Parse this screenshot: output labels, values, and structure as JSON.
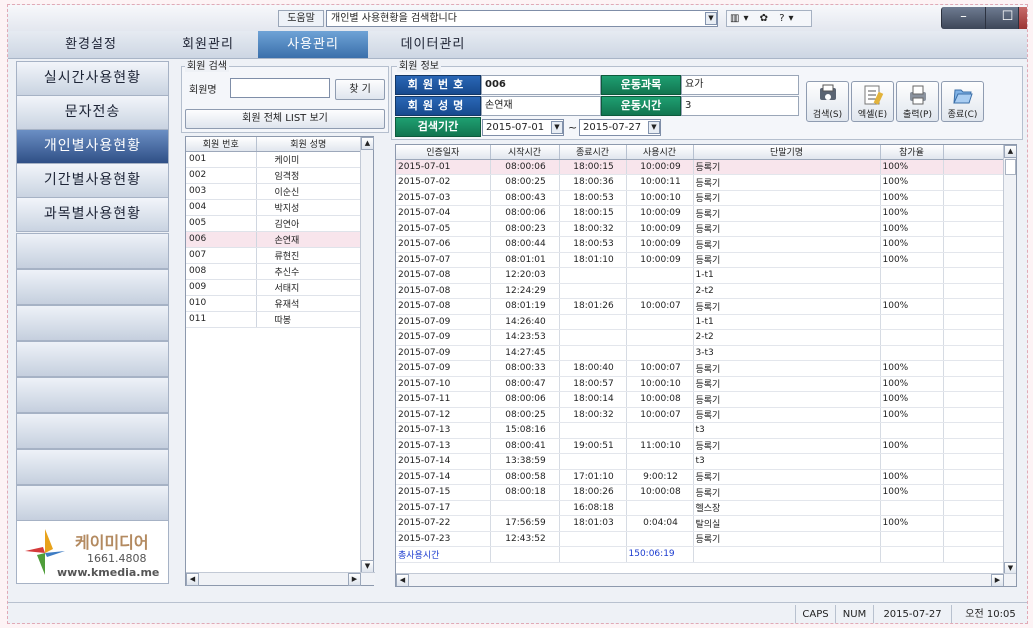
{
  "titlebar": {
    "help_label": "도움말",
    "search_text": "개인별 사용현황을 검색합니다",
    "tools": "▥▾ ✿ ?▾"
  },
  "window_controls": {
    "minimize": "–",
    "maximize": "☐",
    "close": "✕"
  },
  "menu": [
    {
      "label": "환경설정"
    },
    {
      "label": "회원관리"
    },
    {
      "label": "사용관리",
      "active": true
    },
    {
      "label": "데이터관리"
    }
  ],
  "sidebar": {
    "items": [
      {
        "label": "실시간사용현황"
      },
      {
        "label": "문자전송"
      },
      {
        "label": "개인별사용현황",
        "active": true
      },
      {
        "label": "기간별사용현황"
      },
      {
        "label": "과목별사용현황"
      }
    ],
    "logo": {
      "name": "케이미디어",
      "phone": "1661.4808",
      "url": "www.kmedia.me"
    }
  },
  "member_search": {
    "group_title": "회원 검색",
    "name_label": "회원명",
    "name_value": "",
    "find_button": "찾 기",
    "list_button": "회원 전체 LIST 보기",
    "columns": [
      "회원 번호",
      "회원 성명"
    ],
    "rows": [
      [
        "001",
        "케이미"
      ],
      [
        "002",
        "임격정"
      ],
      [
        "003",
        "이순신"
      ],
      [
        "004",
        "박지성"
      ],
      [
        "005",
        "김연아"
      ],
      [
        "006",
        "손연재"
      ],
      [
        "007",
        "류현진"
      ],
      [
        "008",
        "추신수"
      ],
      [
        "009",
        "서태지"
      ],
      [
        "010",
        "유재석"
      ],
      [
        "011",
        "따봉"
      ]
    ],
    "selected_index": 5
  },
  "member_info": {
    "group_title": "회원 정보",
    "member_no_label": "회원번호",
    "member_no": "006",
    "member_name_label": "회원성명",
    "member_name": "손연재",
    "course_label": "운동과목",
    "course": "요가",
    "duration_label": "운동시간",
    "duration": "3",
    "period_label": "검색기간",
    "date_from": "2015-07-01",
    "date_to": "2015-07-27",
    "date_sep": "~",
    "buttons": {
      "search": "검색(S)",
      "excel": "엑셀(E)",
      "print": "출력(P)",
      "exit": "종료(C)"
    }
  },
  "log_table": {
    "columns": [
      "인증일자",
      "시작시간",
      "종료시간",
      "사용시간",
      "단말기명",
      "참가율"
    ],
    "rows": [
      [
        "2015-07-01",
        "08:00:06",
        "18:00:15",
        "10:00:09",
        "등록기",
        "100%"
      ],
      [
        "2015-07-02",
        "08:00:25",
        "18:00:36",
        "10:00:11",
        "등록기",
        "100%"
      ],
      [
        "2015-07-03",
        "08:00:43",
        "18:00:53",
        "10:00:10",
        "등록기",
        "100%"
      ],
      [
        "2015-07-04",
        "08:00:06",
        "18:00:15",
        "10:00:09",
        "등록기",
        "100%"
      ],
      [
        "2015-07-05",
        "08:00:23",
        "18:00:32",
        "10:00:09",
        "등록기",
        "100%"
      ],
      [
        "2015-07-06",
        "08:00:44",
        "18:00:53",
        "10:00:09",
        "등록기",
        "100%"
      ],
      [
        "2015-07-07",
        "08:01:01",
        "18:01:10",
        "10:00:09",
        "등록기",
        "100%"
      ],
      [
        "2015-07-08",
        "12:20:03",
        "",
        "",
        "1-t1",
        ""
      ],
      [
        "2015-07-08",
        "12:24:29",
        "",
        "",
        "2-t2",
        ""
      ],
      [
        "2015-07-08",
        "08:01:19",
        "18:01:26",
        "10:00:07",
        "등록기",
        "100%"
      ],
      [
        "2015-07-09",
        "14:26:40",
        "",
        "",
        "1-t1",
        ""
      ],
      [
        "2015-07-09",
        "14:23:53",
        "",
        "",
        "2-t2",
        ""
      ],
      [
        "2015-07-09",
        "14:27:45",
        "",
        "",
        "3-t3",
        ""
      ],
      [
        "2015-07-09",
        "08:00:33",
        "18:00:40",
        "10:00:07",
        "등록기",
        "100%"
      ],
      [
        "2015-07-10",
        "08:00:47",
        "18:00:57",
        "10:00:10",
        "등록기",
        "100%"
      ],
      [
        "2015-07-11",
        "08:00:06",
        "18:00:14",
        "10:00:08",
        "등록기",
        "100%"
      ],
      [
        "2015-07-12",
        "08:00:25",
        "18:00:32",
        "10:00:07",
        "등록기",
        "100%"
      ],
      [
        "2015-07-13",
        "15:08:16",
        "",
        "",
        "t3",
        ""
      ],
      [
        "2015-07-13",
        "08:00:41",
        "19:00:51",
        "11:00:10",
        "등록기",
        "100%"
      ],
      [
        "2015-07-14",
        "13:38:59",
        "",
        "",
        "t3",
        ""
      ],
      [
        "2015-07-14",
        "08:00:58",
        "17:01:10",
        "9:00:12",
        "등록기",
        "100%"
      ],
      [
        "2015-07-15",
        "08:00:18",
        "18:00:26",
        "10:00:08",
        "등록기",
        "100%"
      ],
      [
        "2015-07-17",
        "",
        "16:08:18",
        "",
        "헬스장",
        ""
      ],
      [
        "2015-07-22",
        "17:56:59",
        "18:01:03",
        "0:04:04",
        "탈의실",
        "100%"
      ],
      [
        "2015-07-23",
        "12:43:52",
        "",
        "",
        "등록기",
        ""
      ]
    ],
    "total_label": "총사용시간",
    "total_value": "150:06:19",
    "selected_index": 0
  },
  "status": {
    "caps": "CAPS",
    "num": "NUM",
    "date": "2015-07-27",
    "time": "오전 10:05"
  },
  "colors": {
    "accent": "#3a6fab",
    "label_blue": "#1f5aa3",
    "label_green": "#17895f",
    "selected_row": "#f8e5ec",
    "total_text": "#1c3ccf"
  }
}
